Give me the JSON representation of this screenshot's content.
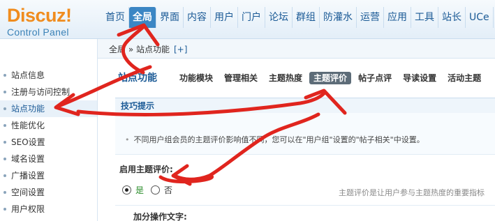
{
  "logo": {
    "word": "Discuz!",
    "sub": "Control Panel"
  },
  "topnav": {
    "items": [
      {
        "label": "首页"
      },
      {
        "label": "全局",
        "active": true
      },
      {
        "label": "界面"
      },
      {
        "label": "内容"
      },
      {
        "label": "用户"
      },
      {
        "label": "门户"
      },
      {
        "label": "论坛"
      },
      {
        "label": "群组"
      },
      {
        "label": "防灌水"
      },
      {
        "label": "运营"
      },
      {
        "label": "应用"
      },
      {
        "label": "工具"
      },
      {
        "label": "站长"
      },
      {
        "label": "UCe"
      }
    ]
  },
  "breadcrumb": {
    "text": "全局 » 站点功能",
    "add": "[+]"
  },
  "sidebar": {
    "items": [
      {
        "label": "站点信息"
      },
      {
        "label": "注册与访问控制"
      },
      {
        "label": "站点功能",
        "active": true
      },
      {
        "label": "性能优化"
      },
      {
        "label": "SEO设置"
      },
      {
        "label": "域名设置"
      },
      {
        "label": "广播设置"
      },
      {
        "label": "空间设置"
      },
      {
        "label": "用户权限"
      }
    ]
  },
  "main": {
    "title": "站点功能",
    "tabs": [
      {
        "label": "功能模块"
      },
      {
        "label": "管理相关"
      },
      {
        "label": "主题热度"
      },
      {
        "label": "主题评价",
        "active": true
      },
      {
        "label": "帖子点评"
      },
      {
        "label": "导读设置"
      },
      {
        "label": "活动主题"
      }
    ],
    "tips_head": "技巧提示",
    "tips_text": "不同用户组会员的主题评价影响值不同，您可以在\"用户组\"设置的\"帖子相关\"中设置。",
    "setting_label": "启用主题评价:",
    "radio_yes": "是",
    "radio_no": "否",
    "setting_desc": "主题评价是让用户参与主题热度的重要指标",
    "setting_label_2": "加分操作文字:"
  },
  "colors": {
    "accent": "#3b86c4",
    "brand": "#f08c1e",
    "annotation": "#e0251e"
  }
}
